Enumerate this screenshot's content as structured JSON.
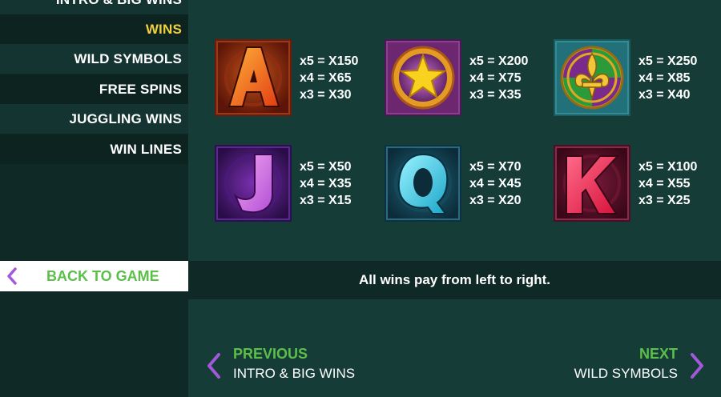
{
  "sidebar": {
    "items": [
      {
        "label": "INTRO & BIG WINS"
      },
      {
        "label": "WINS"
      },
      {
        "label": "WILD SYMBOLS"
      },
      {
        "label": "FREE SPINS"
      },
      {
        "label": "JUGGLING WINS"
      },
      {
        "label": "WIN LINES"
      }
    ],
    "back_label": "BACK TO GAME"
  },
  "symbols": [
    {
      "name": "A",
      "icon": "letter-a-icon",
      "color": "#e8661a",
      "pays": [
        "x5 = X150",
        "x4 = X65",
        "x3 = X30"
      ]
    },
    {
      "name": "Star",
      "icon": "star-icon",
      "color": "#f3c21f",
      "pays": [
        "x5 = X200",
        "x4 = X75",
        "x3 = X35"
      ]
    },
    {
      "name": "Fleur-de-lis",
      "icon": "fleur-de-lis-icon",
      "color": "#e0a822",
      "pays": [
        "x5 = X250",
        "x4 = X85",
        "x3 = X40"
      ]
    },
    {
      "name": "J",
      "icon": "letter-j-icon",
      "color": "#c66adf",
      "pays": [
        "x5 = X50",
        "x4 = X35",
        "x3 = X15"
      ]
    },
    {
      "name": "Q",
      "icon": "letter-q-icon",
      "color": "#2fd0e0",
      "pays": [
        "x5 = X70",
        "x4 = X45",
        "x3 = X20"
      ]
    },
    {
      "name": "K",
      "icon": "letter-k-icon",
      "color": "#e8264f",
      "pays": [
        "x5 = X100",
        "x4 = X55",
        "x3 = X25"
      ]
    }
  ],
  "info": "All wins pay from left to right.",
  "nav": {
    "previous": {
      "title": "PREVIOUS",
      "target": "INTRO & BIG WINS"
    },
    "next": {
      "title": "NEXT",
      "target": "WILD SYMBOLS"
    }
  },
  "colors": {
    "accent_green": "#5cbf4a",
    "active_yellow": "#f4d03f",
    "arrow_purple": "#a259d9"
  }
}
